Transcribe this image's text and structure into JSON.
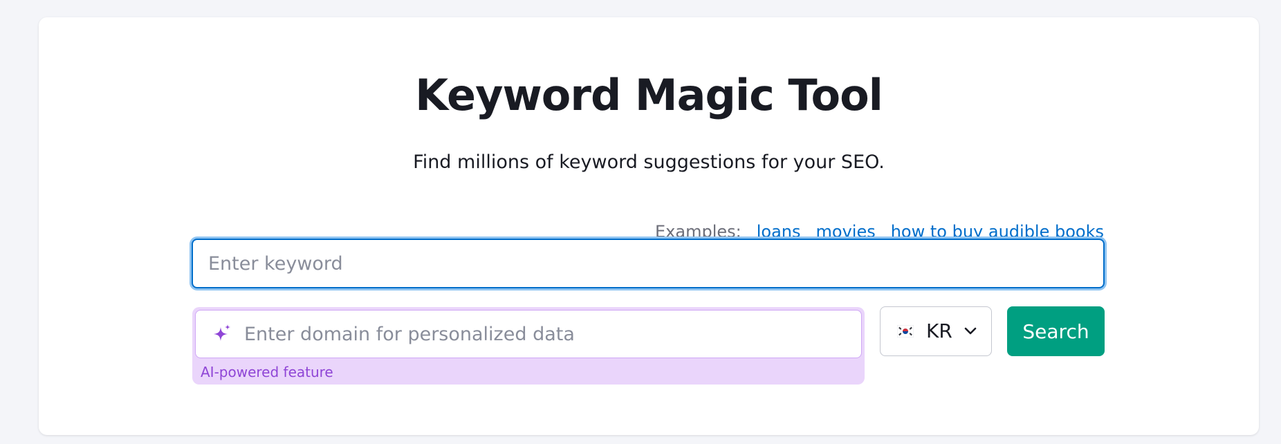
{
  "header": {
    "title": "Keyword Magic Tool",
    "subtitle": "Find millions of keyword suggestions for your SEO."
  },
  "examples": {
    "label": "Examples:",
    "links": [
      "loans",
      "movies",
      "how to buy audible books"
    ]
  },
  "keyword_input": {
    "value": "",
    "placeholder": "Enter keyword"
  },
  "domain_input": {
    "value": "",
    "placeholder": "Enter domain for personalized data",
    "icon": "sparkle-icon",
    "note": "AI-powered feature"
  },
  "country_select": {
    "selected": "KR",
    "flag": "south-korea-flag-icon"
  },
  "search_button": {
    "label": "Search"
  },
  "colors": {
    "accent_blue": "#006dca",
    "search_green": "#009f81",
    "ai_purple": "#8f45d6",
    "ai_background": "#ead5fb"
  }
}
